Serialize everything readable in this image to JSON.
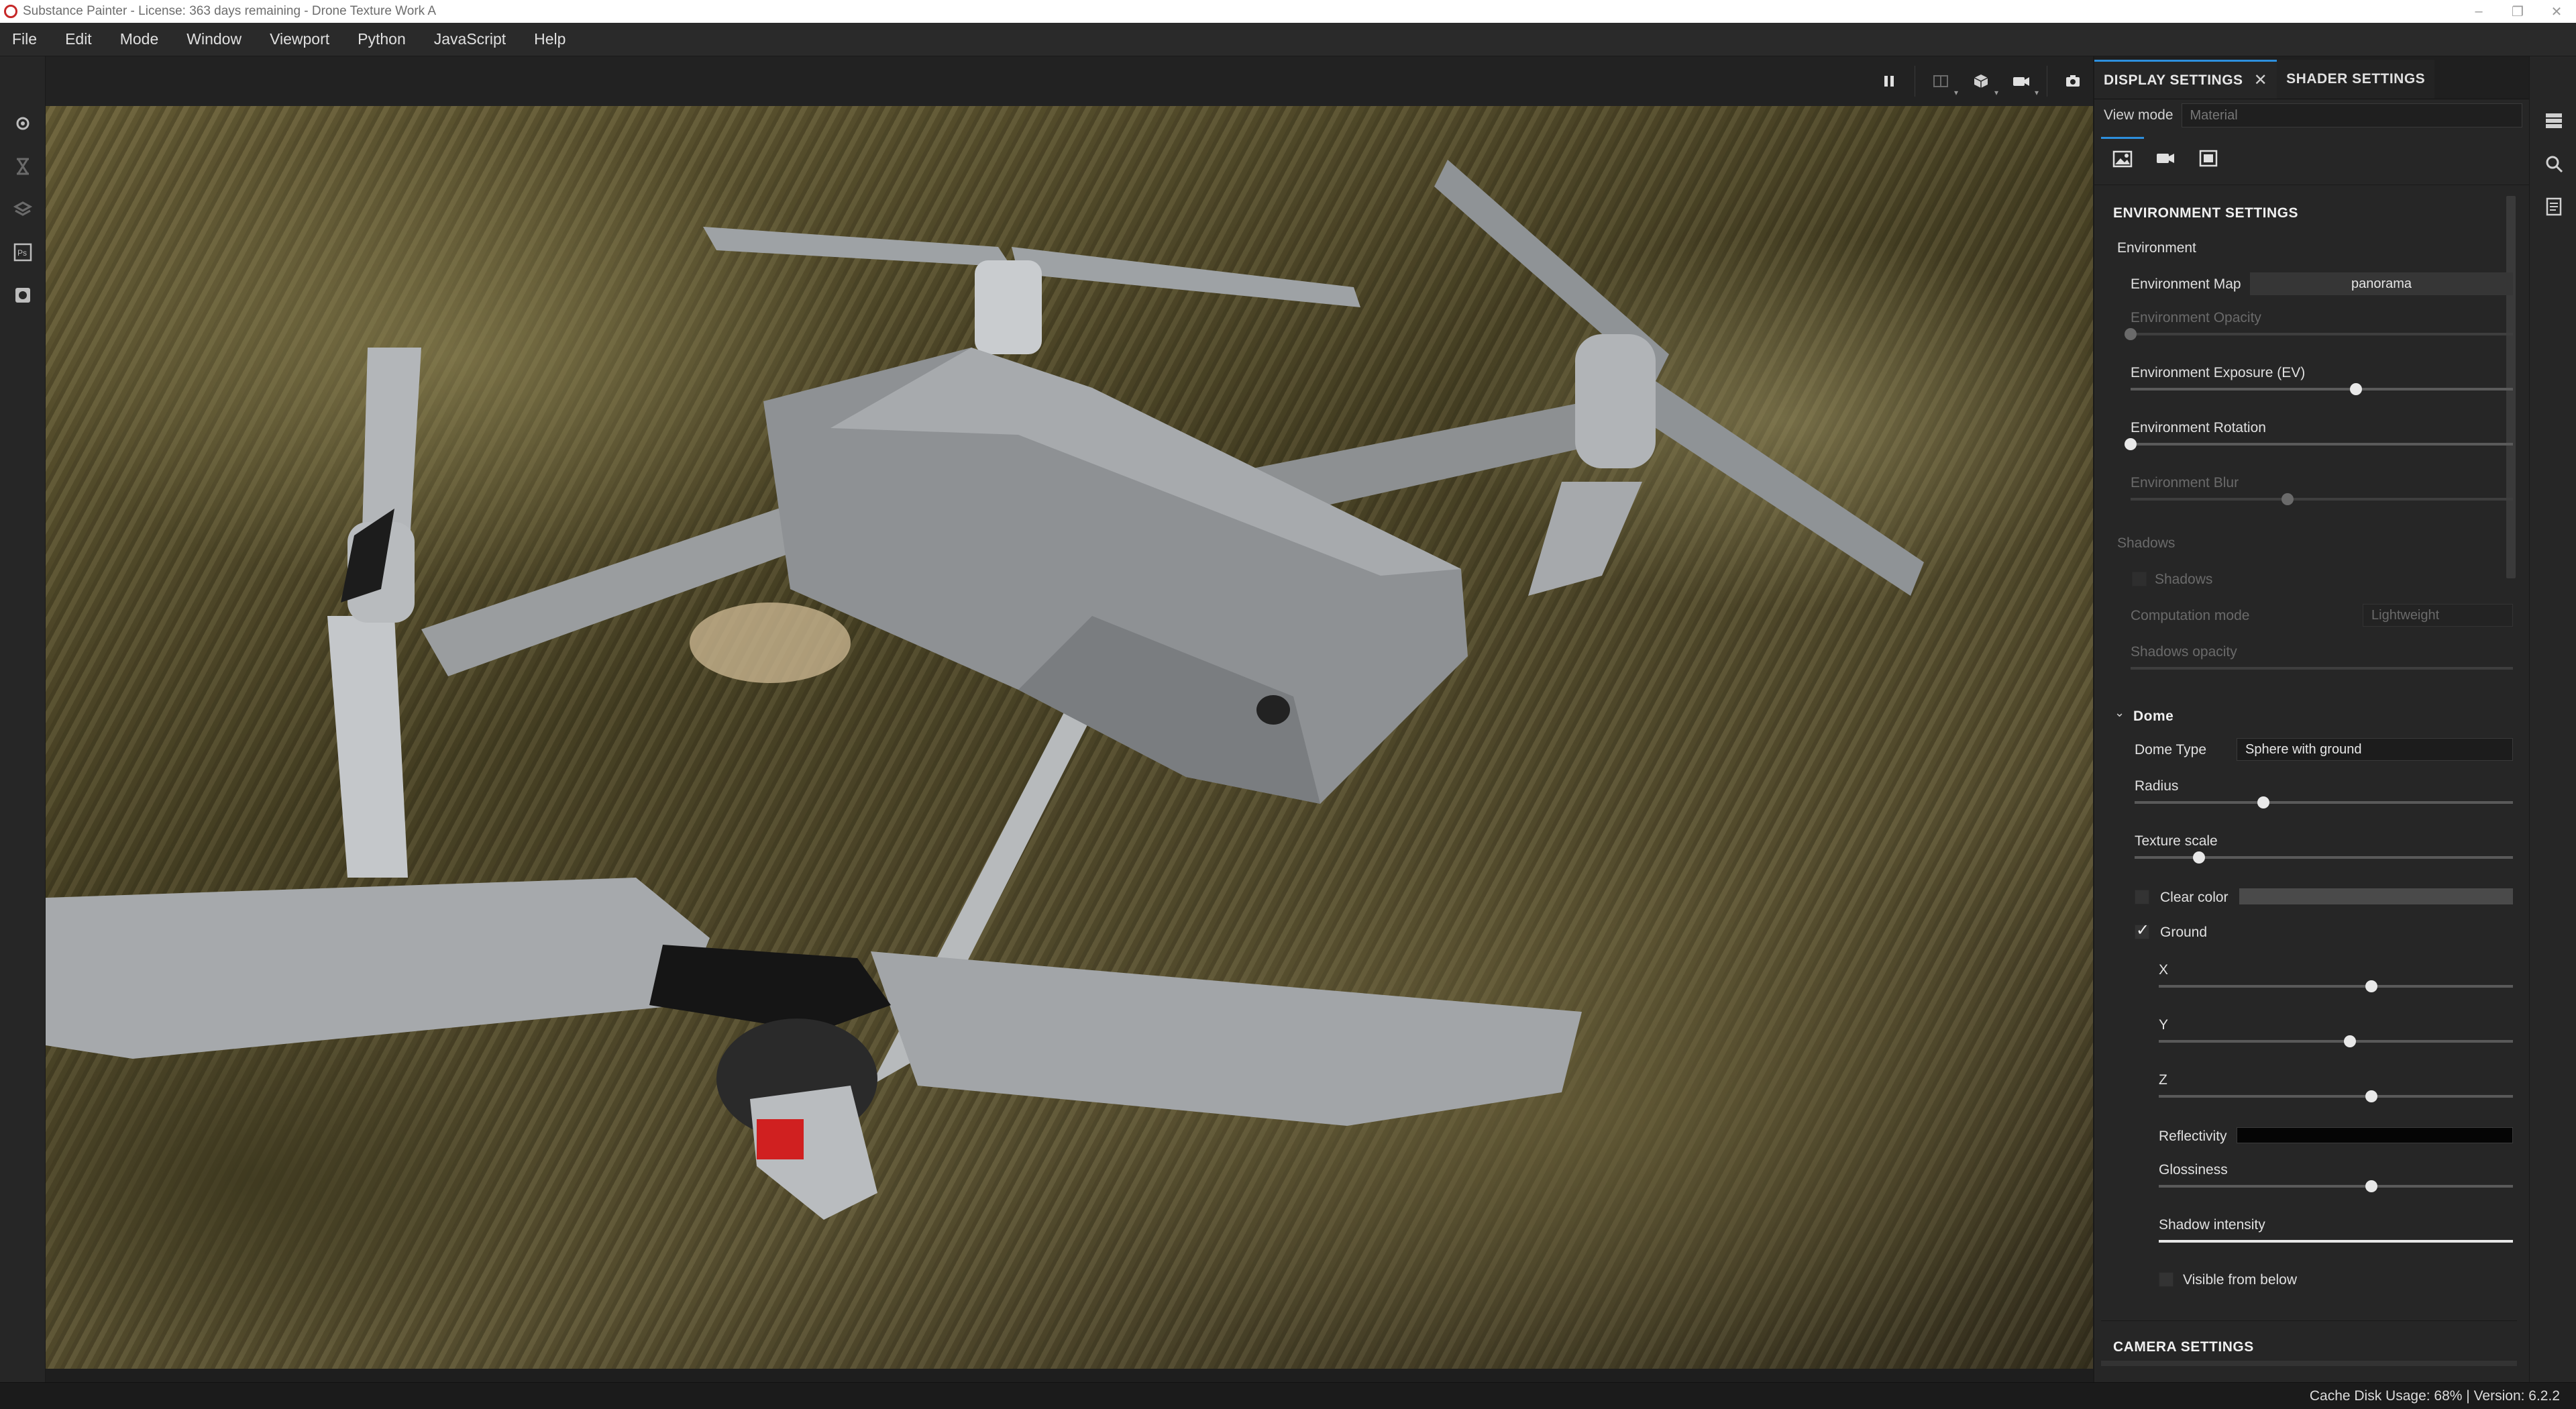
{
  "window": {
    "title": "Substance Painter - License: 363 days remaining - Drone Texture Work A",
    "controls": [
      "–",
      "❐",
      "✕"
    ]
  },
  "menu": [
    "File",
    "Edit",
    "Mode",
    "Window",
    "Viewport",
    "Python",
    "JavaScript",
    "Help"
  ],
  "left_toolbar": [
    "settings-icon",
    "hourglass-icon",
    "layers-icon",
    "photoshop-icon",
    "paint-icon"
  ],
  "viewport_toolbar": [
    "pause-icon",
    "split-view-icon",
    "cube-icon",
    "camera-icon",
    "screenshot-icon"
  ],
  "panel": {
    "tabs": [
      {
        "label": "DISPLAY SETTINGS",
        "active": true,
        "close": "✕"
      },
      {
        "label": "SHADER SETTINGS",
        "active": false
      }
    ],
    "view_mode": {
      "label": "View mode",
      "value": "Material"
    },
    "icon_tabs": [
      "image-icon",
      "camera-icon",
      "frame-icon"
    ],
    "environment": {
      "header": "ENVIRONMENT SETTINGS",
      "group": "Environment",
      "env_map": {
        "label": "Environment Map",
        "value": "panorama"
      },
      "opacity": {
        "label": "Environment Opacity",
        "value": 0.0,
        "enabled": false
      },
      "exposure": {
        "label": "Environment Exposure (EV)",
        "value": 0.59,
        "enabled": true
      },
      "rotation": {
        "label": "Environment Rotation",
        "value": 0.0,
        "enabled": true
      },
      "blur": {
        "label": "Environment Blur",
        "value": 0.41,
        "enabled": false
      },
      "shadows_group": "Shadows",
      "shadows_check": "Shadows",
      "computation_mode": {
        "label": "Computation mode",
        "value": "Lightweight"
      },
      "shadows_opacity": {
        "label": "Shadows opacity"
      }
    },
    "dome": {
      "header": "Dome",
      "dome_type": {
        "label": "Dome Type",
        "value": "Sphere with ground"
      },
      "radius": {
        "label": "Radius",
        "value": 0.34
      },
      "texture_scale": {
        "label": "Texture scale",
        "value": 0.17
      },
      "clear_color": {
        "label": "Clear color",
        "checked": false
      },
      "ground": {
        "label": "Ground",
        "checked": true
      },
      "x": {
        "label": "X",
        "value": 0.6
      },
      "y": {
        "label": "Y",
        "value": 0.54
      },
      "z": {
        "label": "Z",
        "value": 0.6
      },
      "reflectivity": {
        "label": "Reflectivity"
      },
      "glossiness": {
        "label": "Glossiness",
        "value": 0.6
      },
      "shadow_intensity": {
        "label": "Shadow intensity",
        "value": 1.0
      },
      "visible_from_below": {
        "label": "Visible from below",
        "checked": false
      }
    },
    "camera_header": "CAMERA SETTINGS"
  },
  "right_toolbar": [
    "texture-set-icon",
    "zoom-icon",
    "properties-icon"
  ],
  "status": "Cache Disk Usage: 68% | Version: 6.2.2",
  "colors": {
    "accent": "#2d8fdd",
    "panel_bg": "#262626",
    "statusbar_bg": "#1b1b1b"
  }
}
